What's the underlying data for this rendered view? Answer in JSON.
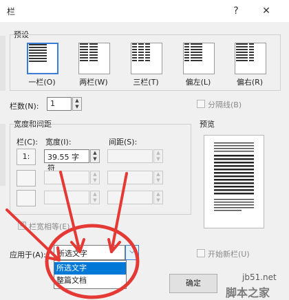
{
  "window": {
    "title": "栏",
    "help_symbol": "?",
    "close_symbol": "✕"
  },
  "presets": {
    "group_label": "预设",
    "items": [
      {
        "label": "一栏(O)",
        "columns": 1,
        "selected": true
      },
      {
        "label": "两栏(W)",
        "columns": 2,
        "selected": false
      },
      {
        "label": "三栏(T)",
        "columns": 3,
        "selected": false
      },
      {
        "label": "偏左(L)",
        "columns": 2,
        "selected": false
      },
      {
        "label": "偏右(R)",
        "columns": 2,
        "selected": false
      }
    ]
  },
  "columns_count": {
    "label": "栏数(N):",
    "value": "1"
  },
  "separator": {
    "label": "分隔线(B)",
    "checked": false
  },
  "width_spacing": {
    "group_label": "宽度和间距",
    "col_header": "栏(C):",
    "width_header": "宽度(I):",
    "spacing_header": "间距(S):",
    "rows": [
      {
        "col": "1:",
        "width": "39.55 字符",
        "spacing": ""
      },
      {
        "col": "",
        "width": "",
        "spacing": ""
      },
      {
        "col": "",
        "width": "",
        "spacing": ""
      }
    ],
    "equal_width_label": "栏宽相等(E)",
    "equal_width_checked": true
  },
  "preview": {
    "group_label": "预览"
  },
  "apply_to": {
    "label": "应用于(A):",
    "value": "所选文字",
    "options": [
      "所选文字",
      "整篇文档"
    ]
  },
  "new_column": {
    "label": "开始新栏(U)",
    "checked": false
  },
  "buttons": {
    "ok_partial": "确定"
  },
  "watermark": {
    "site": "jb51.net",
    "name": "脚本之家"
  },
  "colors": {
    "accent": "#0078d7",
    "annotation": "#e53935"
  }
}
